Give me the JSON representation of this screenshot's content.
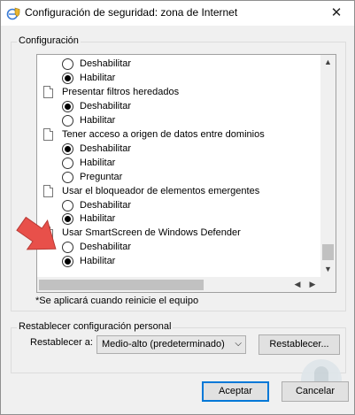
{
  "window": {
    "title": "Configuración de seguridad: zona de Internet"
  },
  "config_group": {
    "label": "Configuración",
    "rows": [
      {
        "type": "radio",
        "label": "Deshabilitar",
        "checked": false
      },
      {
        "type": "radio",
        "label": "Habilitar",
        "checked": true
      },
      {
        "type": "category",
        "label": "Presentar filtros heredados"
      },
      {
        "type": "radio",
        "label": "Deshabilitar",
        "checked": true
      },
      {
        "type": "radio",
        "label": "Habilitar",
        "checked": false
      },
      {
        "type": "category",
        "label": "Tener acceso a origen de datos entre dominios"
      },
      {
        "type": "radio",
        "label": "Deshabilitar",
        "checked": true
      },
      {
        "type": "radio",
        "label": "Habilitar",
        "checked": false
      },
      {
        "type": "radio",
        "label": "Preguntar",
        "checked": false
      },
      {
        "type": "category",
        "label": "Usar el bloqueador de elementos emergentes"
      },
      {
        "type": "radio",
        "label": "Deshabilitar",
        "checked": false
      },
      {
        "type": "radio",
        "label": "Habilitar",
        "checked": true
      },
      {
        "type": "category",
        "label": "Usar SmartScreen de Windows Defender"
      },
      {
        "type": "radio",
        "label": "Deshabilitar",
        "checked": false
      },
      {
        "type": "radio",
        "label": "Habilitar",
        "checked": true
      }
    ],
    "note": "*Se aplicará cuando reinicie el equipo"
  },
  "reset_group": {
    "label": "Restablecer configuración personal",
    "reset_to_label": "Restablecer a:",
    "selected_level": "Medio-alto (predeterminado)",
    "reset_button": "Restablecer..."
  },
  "footer": {
    "ok": "Aceptar",
    "cancel": "Cancelar"
  },
  "icons": {
    "title": "ie-shield-icon",
    "close": "close-icon",
    "category": "document-icon",
    "annotation": "red-arrow-icon"
  },
  "colors": {
    "annotation_arrow": "#e8504a",
    "primary_border": "#0078d7"
  }
}
